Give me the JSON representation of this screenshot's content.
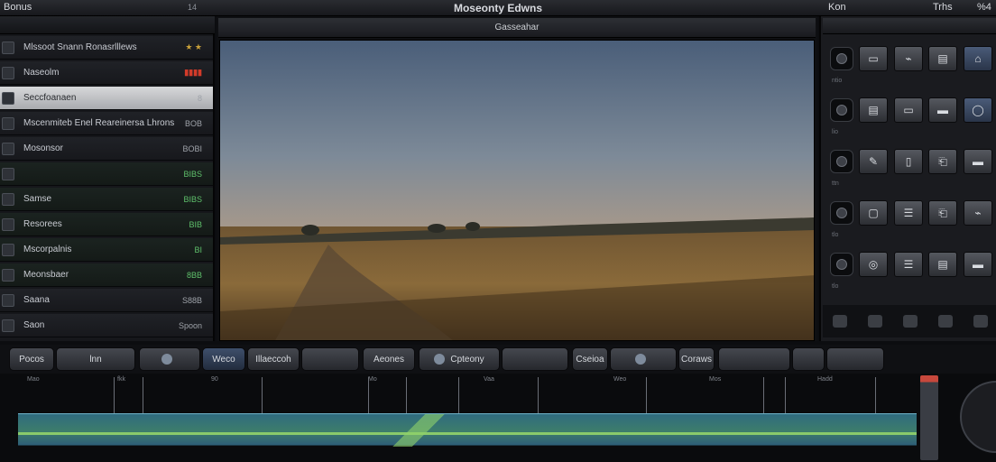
{
  "topbar": {
    "left_title": "Bonus",
    "left_num": "14",
    "center_title": "Moseonty Edwns",
    "right_title": "Kon",
    "right_second": "Trhs",
    "right_third": "%4"
  },
  "left_panel": {
    "layers": [
      {
        "name": "Mlssoot Snann Ronasrlllews",
        "value": "★ ★",
        "style": "normal"
      },
      {
        "name": "Naseolm",
        "value": "▮▮▮▮",
        "style": "red"
      },
      {
        "name": "Seccfoanaen",
        "value": "8",
        "style": "selected"
      },
      {
        "name": "Mscenmiteb Enel Reareinersa Lhrons",
        "value": "BOB",
        "style": "normal"
      },
      {
        "name": "Mosonsor",
        "value": "BOBI",
        "style": "normal"
      },
      {
        "name": "",
        "value": "BIBS",
        "style": "green"
      },
      {
        "name": "Samse",
        "value": "BIBS",
        "style": "green"
      },
      {
        "name": "Resorees",
        "value": "BIB",
        "style": "green"
      },
      {
        "name": "Mscorpalnis",
        "value": "BI",
        "style": "green"
      },
      {
        "name": "Meonsbaer",
        "value": "8BB",
        "style": "green"
      },
      {
        "name": "Saana",
        "value": "S88B",
        "style": "normal"
      },
      {
        "name": "Saon",
        "value": "Spoon",
        "style": "normal"
      }
    ]
  },
  "viewer": {
    "header": "Gasseahar"
  },
  "right_panel": {
    "row_labels": [
      "ntio",
      "lio",
      "ttn",
      "tlo",
      "tlo"
    ]
  },
  "toolbar": {
    "buttons": [
      "Pocos",
      "lnn",
      "",
      "Weco",
      "Illaeccoh",
      "",
      "Aeones",
      "Cpteony",
      "",
      "Cseioa",
      "",
      "Coraws",
      "",
      "",
      ""
    ]
  },
  "timeline": {
    "ticks": [
      "Mao",
      "fkk",
      "90",
      "Mo",
      "Vaa",
      "Weo",
      "Mos",
      "Hadd"
    ]
  }
}
